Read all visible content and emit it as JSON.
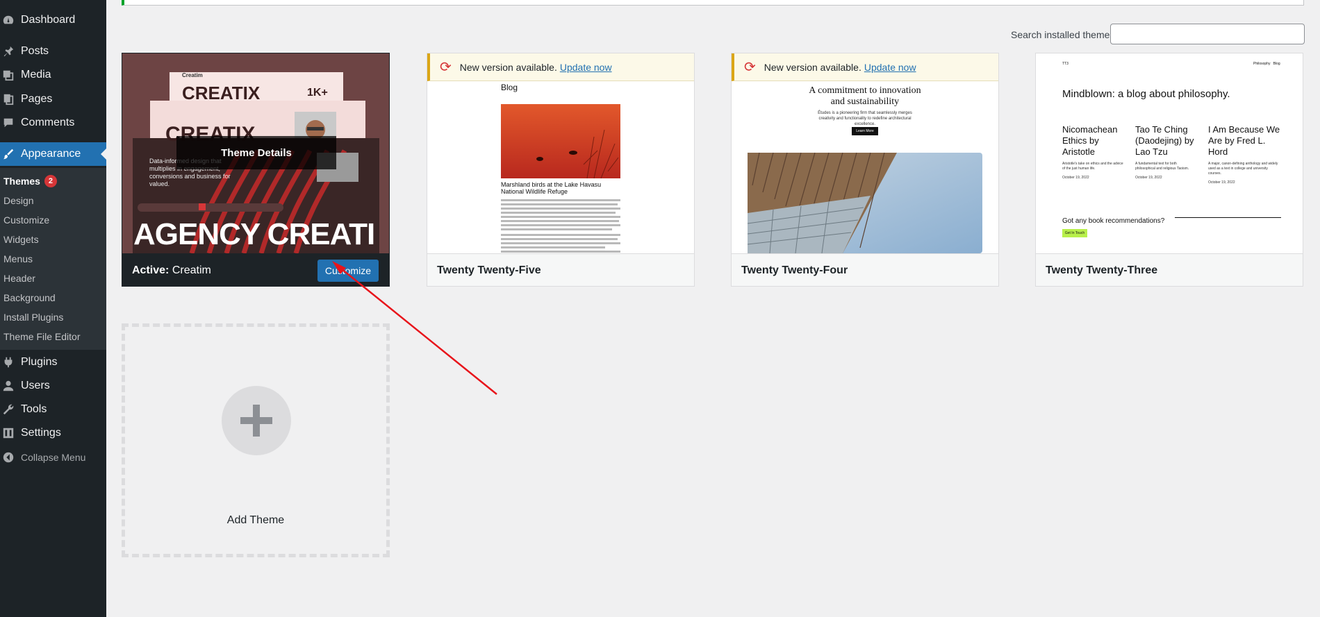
{
  "sidebar": {
    "items": [
      {
        "label": "Dashboard",
        "icon": "dashboard-icon"
      },
      {
        "label": "Posts",
        "icon": "pin-icon"
      },
      {
        "label": "Media",
        "icon": "media-icon"
      },
      {
        "label": "Pages",
        "icon": "pages-icon"
      },
      {
        "label": "Comments",
        "icon": "comment-icon"
      },
      {
        "label": "Appearance",
        "icon": "brush-icon"
      },
      {
        "label": "Plugins",
        "icon": "plug-icon"
      },
      {
        "label": "Users",
        "icon": "user-icon"
      },
      {
        "label": "Tools",
        "icon": "wrench-icon"
      },
      {
        "label": "Settings",
        "icon": "settings-icon"
      }
    ],
    "submenu": [
      {
        "label": "Themes",
        "badge": "2"
      },
      {
        "label": "Design"
      },
      {
        "label": "Customize"
      },
      {
        "label": "Widgets"
      },
      {
        "label": "Menus"
      },
      {
        "label": "Header"
      },
      {
        "label": "Background"
      },
      {
        "label": "Install Plugins"
      },
      {
        "label": "Theme File Editor"
      }
    ],
    "collapse_label": "Collapse Menu"
  },
  "search": {
    "label": "Search installed themes",
    "value": ""
  },
  "active_theme": {
    "active_prefix": "Active:",
    "name": "Creatim",
    "customize_label": "Customize",
    "details_label": "Theme Details",
    "preview": {
      "logo": "Creatim",
      "headline_1": "CREATIX",
      "headline_2": "CREATIX",
      "stat": "1K+",
      "blurb": "Data-informed design that multiplies in engagement, conversions and business for valued.",
      "banner": "AGENCY CREATI"
    }
  },
  "themes": [
    {
      "name": "Twenty Twenty-Five",
      "update_text": "New version available.",
      "update_link": "Update now",
      "preview": {
        "heading": "Blog",
        "caption": "Marshland birds at the Lake Havasu National Wildlife Refuge"
      }
    },
    {
      "name": "Twenty Twenty-Four",
      "update_text": "New version available.",
      "update_link": "Update now",
      "preview": {
        "heading_1": "A commitment to innovation",
        "heading_2": "and sustainability",
        "body": "Études is a pioneering firm that seamlessly merges creativity and functionality to redefine architectural excellence.",
        "button": "Learn More"
      }
    },
    {
      "name": "Twenty Twenty-Three",
      "preview": {
        "site": "TT3",
        "nav_1": "Philosophy",
        "nav_2": "Blog",
        "headline": "Mindblown: a blog about philosophy.",
        "posts": [
          {
            "title": "Nicomachean Ethics by Aristotle",
            "excerpt": "Aristotle's take on ethics and the advice of the just human life.",
            "date": "October 19, 2022"
          },
          {
            "title": "Tao Te Ching (Daodejing) by Lao Tzu",
            "excerpt": "A fundamental text for both philosophical and religious Taoism.",
            "date": "October 19, 2022"
          },
          {
            "title": "I Am Because We Are by Fred L. Hord",
            "excerpt": "A major, canon-defining anthology and widely used as a text in college and university courses.",
            "date": "October 19, 2022"
          }
        ],
        "cta": "Got any book recommendations?",
        "cta_button": "Get In Touch"
      }
    }
  ],
  "add_theme": {
    "label": "Add Theme"
  },
  "colors": {
    "admin_bar": "#1d2327",
    "accent": "#2271b1",
    "badge": "#d63638",
    "update_bg": "#fcf9e8",
    "arrow": "#e8141b"
  }
}
